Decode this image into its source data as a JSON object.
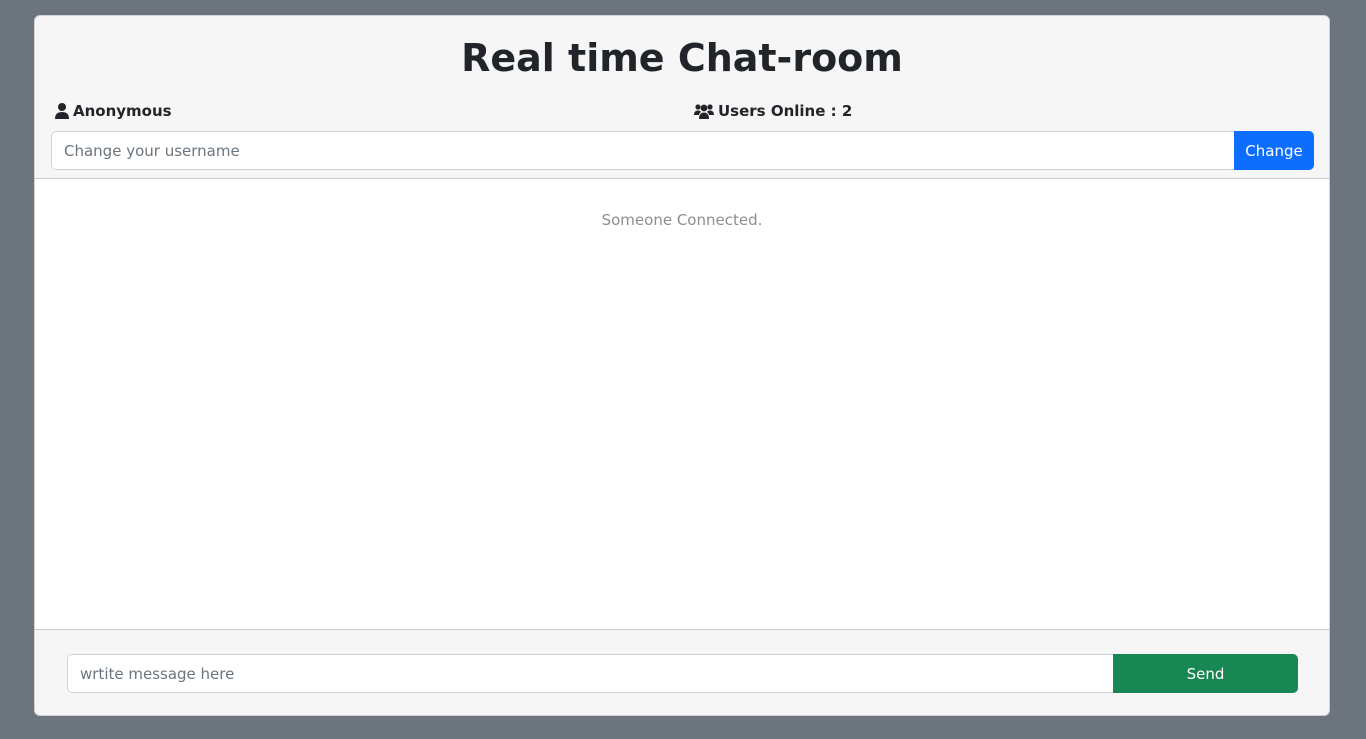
{
  "header": {
    "title": "Real time Chat-room",
    "username": "Anonymous",
    "users_online": "Users Online : 2",
    "username_placeholder": "Change your username",
    "change_label": "Change"
  },
  "chat": {
    "messages": [
      "Someone Connected."
    ]
  },
  "footer": {
    "message_placeholder": "wrtite message here",
    "send_label": "Send"
  },
  "colors": {
    "background": "#6c757d",
    "primary": "#0d6efd",
    "success": "#198754",
    "system_text": "#8e8e8e"
  },
  "icons": {
    "user": "user-icon",
    "users": "users-icon"
  }
}
